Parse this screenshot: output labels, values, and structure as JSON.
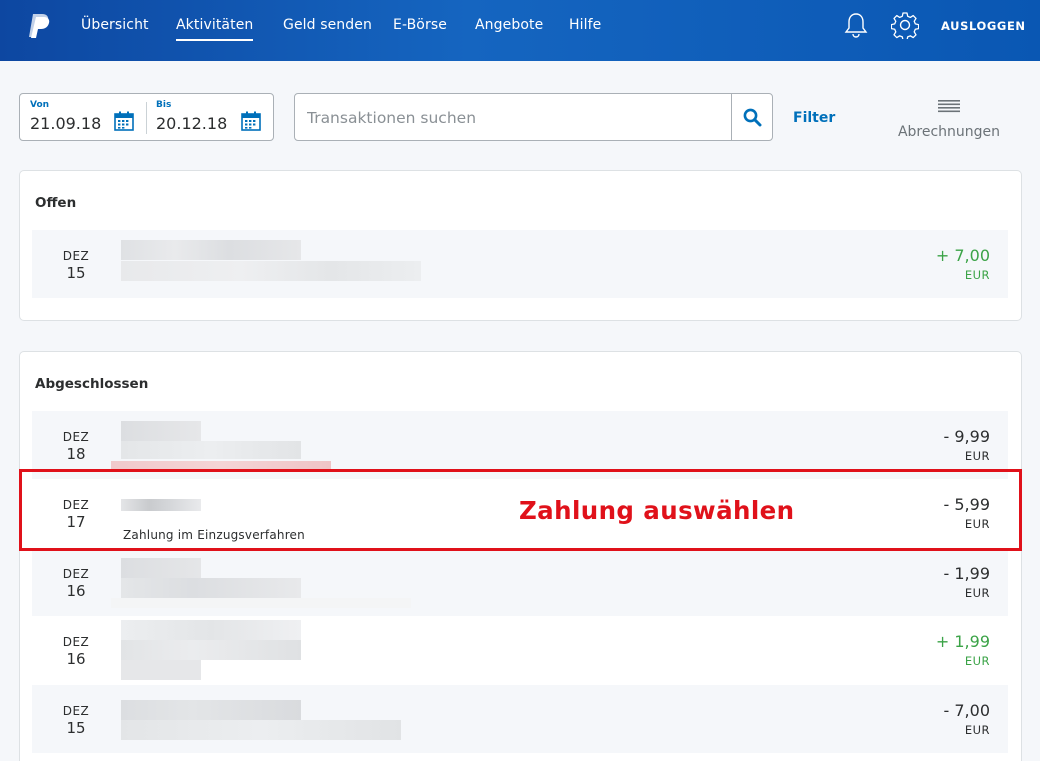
{
  "nav": {
    "items": [
      {
        "label": "Übersicht",
        "active": false
      },
      {
        "label": "Aktivitäten",
        "active": true
      },
      {
        "label": "Geld senden",
        "active": false
      },
      {
        "label": "E-Börse",
        "active": false
      },
      {
        "label": "Angebote",
        "active": false
      },
      {
        "label": "Hilfe",
        "active": false
      }
    ],
    "logout": "AUSLOGGEN",
    "icons": [
      "paypal-logo",
      "bell-icon",
      "gear-icon"
    ]
  },
  "filters": {
    "from_label": "Von",
    "from_value": "21.09.18",
    "to_label": "Bis",
    "to_value": "20.12.18",
    "search_placeholder": "Transaktionen suchen",
    "filter_label": "Filter",
    "statements_label": "Abrechnungen"
  },
  "open_section": {
    "title": "Offen",
    "rows": [
      {
        "month": "DEZ",
        "day": "15",
        "amount": "+ 7,00",
        "currency": "EUR",
        "positive": true
      }
    ]
  },
  "completed_section": {
    "title": "Abgeschlossen",
    "rows": [
      {
        "month": "DEZ",
        "day": "18",
        "amount": "- 9,99",
        "currency": "EUR",
        "positive": false
      },
      {
        "month": "DEZ",
        "day": "17",
        "amount": "- 5,99",
        "currency": "EUR",
        "positive": false,
        "description": "Zahlung im Einzugsverfahren"
      },
      {
        "month": "DEZ",
        "day": "16",
        "amount": "- 1,99",
        "currency": "EUR",
        "positive": false
      },
      {
        "month": "DEZ",
        "day": "16",
        "amount": "+ 1,99",
        "currency": "EUR",
        "positive": true
      },
      {
        "month": "DEZ",
        "day": "15",
        "amount": "- 7,00",
        "currency": "EUR",
        "positive": false
      }
    ]
  },
  "annotation": {
    "text": "Zahlung auswählen",
    "color": "#e0111a"
  },
  "colors": {
    "brand_blue": "#0d47a1",
    "link_blue": "#0070ba",
    "positive_green": "#3ba347"
  }
}
